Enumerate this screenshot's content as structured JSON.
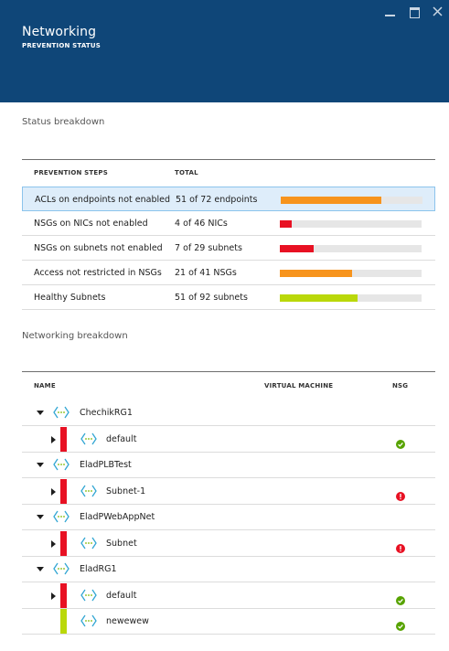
{
  "header": {
    "title": "Networking",
    "subtitle": "PREVENTION STATUS"
  },
  "colors": {
    "header_bg": "#0f4678",
    "orange": "#f7941d",
    "red": "#e81123",
    "lime": "#bad80a",
    "green_ok": "#57a300",
    "selected_bg": "#deedfa"
  },
  "status_section": {
    "title": "Status breakdown",
    "columns": [
      "PREVENTION STEPS",
      "TOTAL"
    ],
    "rows": [
      {
        "step": "ACLs on endpoints not enabled",
        "total": "51 of 72 endpoints",
        "fraction": 0.71,
        "color": "#f7941d",
        "selected": true
      },
      {
        "step": "NSGs on NICs not enabled",
        "total": "4 of 46 NICs",
        "fraction": 0.087,
        "color": "#e81123",
        "selected": false
      },
      {
        "step": "NSGs on subnets not enabled",
        "total": "7 of 29 subnets",
        "fraction": 0.24,
        "color": "#e81123",
        "selected": false
      },
      {
        "step": "Access not restricted in NSGs",
        "total": "21 of 41 NSGs",
        "fraction": 0.51,
        "color": "#f7941d",
        "selected": false
      },
      {
        "step": "Healthy Subnets",
        "total": "51 of 92 subnets",
        "fraction": 0.55,
        "color": "#bad80a",
        "selected": false
      }
    ]
  },
  "networking_section": {
    "title": "Networking breakdown",
    "columns": [
      "NAME",
      "VIRTUAL MACHINE",
      "NSG"
    ],
    "items": [
      {
        "label": "ChechikRG1",
        "level": 0,
        "expanded": true
      },
      {
        "label": "default",
        "level": 1,
        "severity": "#e81123",
        "nsg": "ok"
      },
      {
        "label": "EladPLBTest",
        "level": 0,
        "expanded": true
      },
      {
        "label": "Subnet-1",
        "level": 1,
        "severity": "#e81123",
        "nsg": "error"
      },
      {
        "label": "EladPWebAppNet",
        "level": 0,
        "expanded": true
      },
      {
        "label": "Subnet",
        "level": 1,
        "severity": "#e81123",
        "nsg": "error"
      },
      {
        "label": "EladRG1",
        "level": 0,
        "expanded": true
      },
      {
        "label": "default",
        "level": 1,
        "severity": "#e81123",
        "nsg": "ok"
      },
      {
        "label": "newewew",
        "level": 1,
        "severity": "#bad80a",
        "nsg": "ok",
        "leaf": true
      }
    ]
  }
}
